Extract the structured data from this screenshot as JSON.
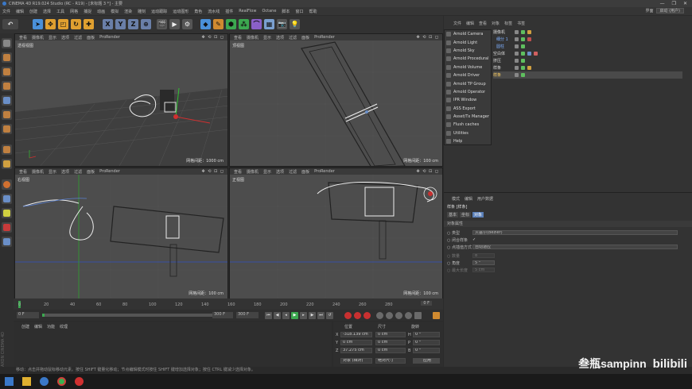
{
  "window": {
    "title": "CINEMA 4D R19.024 Studio (RC - R19) - [未标题 3 *] - 主要",
    "controls": [
      "—",
      "❐",
      "✕"
    ]
  },
  "menubar": {
    "items": [
      "文件",
      "编辑",
      "创建",
      "选择",
      "工具",
      "网格",
      "捕捉",
      "动画",
      "模拟",
      "渲染",
      "雕刻",
      "运动跟踪",
      "运动图形",
      "角色",
      "流水线",
      "插件",
      "RealFlow",
      "Octane",
      "脚本",
      "窗口",
      "帮助"
    ],
    "layout_label": "界面",
    "layout_value": "启动 (用户)"
  },
  "viewport_menu": [
    "查看",
    "摄像机",
    "显示",
    "选项",
    "过滤",
    "面板",
    "ProRender"
  ],
  "viewports": [
    {
      "name": "透视视图",
      "scale": "网格间距：1000 cm"
    },
    {
      "name": "顶视图",
      "scale": "网格间距：100 cm"
    },
    {
      "name": "右视图",
      "scale": "网格间距：100 cm"
    },
    {
      "name": "正视图",
      "scale": "网格间距：100 cm"
    }
  ],
  "plugin_menu": {
    "items": [
      "Arnold Camera",
      "Arnold Light",
      "Arnold Sky",
      "Arnold Procedural",
      "Arnold Volume",
      "Arnold Driver",
      "Arnold TP Group",
      "Arnold Operator",
      "IPR Window",
      "ASS Export",
      "Asset/Tx Manager",
      "Flush caches",
      "Utilities",
      "Help"
    ]
  },
  "object_manager": {
    "menu": [
      "文件",
      "编辑",
      "查看",
      "对象",
      "标签",
      "书签"
    ],
    "objects": [
      {
        "name": "摄像机",
        "color": "#dddddd"
      },
      {
        "name": "细分 1",
        "color": "#7fb0ff"
      },
      {
        "name": "圆柱",
        "color": "#7fb0ff"
      },
      {
        "name": "空白体",
        "color": "#dddddd"
      },
      {
        "name": "挤压",
        "color": "#dddddd"
      },
      {
        "name": "样条",
        "color": "#dddddd"
      },
      {
        "name": "样条",
        "color": "#ffd060"
      }
    ]
  },
  "attribute_manager": {
    "menu": [
      "模式",
      "编辑",
      "用户数据"
    ],
    "title": "样条 [样条]",
    "tabs": [
      "基本",
      "坐标",
      "对象"
    ],
    "section": "对象属性",
    "props": [
      {
        "label": "○ 类型",
        "value": "贝塞尔(Bezier)"
      },
      {
        "label": "○ 闭合样条",
        "value": "✓"
      },
      {
        "label": "○ 点插值方式",
        "value": "自动适应"
      },
      {
        "label": "○ 数量",
        "value": "8"
      },
      {
        "label": "○ 角度",
        "value": "5 °"
      },
      {
        "label": "○ 最大长度",
        "value": "5 cm"
      }
    ]
  },
  "timeline": {
    "ticks": [
      "0",
      "20",
      "40",
      "60",
      "80",
      "100",
      "120",
      "140",
      "160",
      "180",
      "200",
      "220",
      "240",
      "260",
      "280"
    ],
    "current_frame": "0 F",
    "start": "0 F",
    "end": "300 F",
    "end2": "300 F",
    "progress": 0.0
  },
  "material": {
    "menu": [
      "创建",
      "编辑",
      "功能",
      "纹理"
    ]
  },
  "coords": {
    "headers": [
      "位置",
      "尺寸",
      "旋转"
    ],
    "rows": [
      {
        "axis": "X",
        "pos": "-318.139 cm",
        "size": "0 cm",
        "rot_label": "H",
        "rot": "0 °"
      },
      {
        "axis": "Y",
        "pos": "0 cm",
        "size": "0 cm",
        "rot_label": "P",
        "rot": "0 °"
      },
      {
        "axis": "Z",
        "pos": "37.275 cm",
        "size": "0 cm",
        "rot_label": "B",
        "rot": "0 °"
      }
    ],
    "mode": "对象 (相对)",
    "size_mode": "绝对尺寸",
    "apply": "应用"
  },
  "statusbar": "移动：点击并拖动鼠标移动元素。按住 SHIFT 键量化移动；节点编辑模式时按住 SHIFT 键增加选择对象；按住 CTRL 键减少选择对象。",
  "branding": {
    "side": "MAXON CINEMA 4D"
  },
  "watermark": {
    "user": "叁瓶sampinn",
    "logo": "bilibili"
  }
}
